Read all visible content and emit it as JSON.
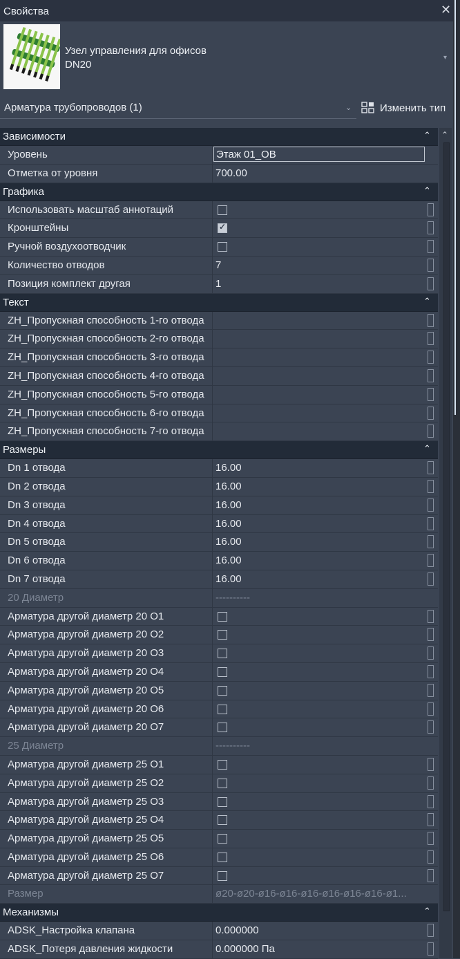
{
  "window": {
    "title": "Свойства",
    "close_symbol": "✕"
  },
  "header": {
    "type_line1": "Узел управления для офисов",
    "type_line2": "DN20",
    "dropdown_symbol": "▾"
  },
  "selector": {
    "value": "Арматура трубопроводов (1)",
    "arrow": "⌄",
    "change_type_label": "Изменить тип"
  },
  "symbols": {
    "collapse": "⌃",
    "scroll_up": "⌃"
  },
  "colors": {
    "panel_bg": "#3b4453",
    "category_bg": "#222b38",
    "titlebar_bg": "#2b3240"
  },
  "properties": [
    {
      "kind": "category",
      "name": "Зависимости"
    },
    {
      "kind": "row",
      "name": "Уровень",
      "value": "Этаж 01_ОВ",
      "edit": true
    },
    {
      "kind": "row",
      "name": "Отметка от уровня",
      "value": "700.00"
    },
    {
      "kind": "category",
      "name": "Графика"
    },
    {
      "kind": "row",
      "name": "Использовать масштаб аннотаций",
      "checkbox": false,
      "assoc": true
    },
    {
      "kind": "row",
      "name": "Кронштейны",
      "checkbox": true,
      "assoc": true
    },
    {
      "kind": "row",
      "name": "Ручной воздухоотводчик",
      "checkbox": false,
      "assoc": true
    },
    {
      "kind": "row",
      "name": "Количество отводов",
      "value": "7",
      "assoc": true
    },
    {
      "kind": "row",
      "name": "Позиция комплект другая",
      "value": "1",
      "assoc": true
    },
    {
      "kind": "category",
      "name": "Текст"
    },
    {
      "kind": "row",
      "name": "ZH_Пропускная способность 1-го отвода",
      "value": "",
      "assoc": true
    },
    {
      "kind": "row",
      "name": "ZH_Пропускная способность 2-го отвода",
      "value": "",
      "assoc": true
    },
    {
      "kind": "row",
      "name": "ZH_Пропускная способность 3-го отвода",
      "value": "",
      "assoc": true
    },
    {
      "kind": "row",
      "name": "ZH_Пропускная способность 4-го отвода",
      "value": "",
      "assoc": true
    },
    {
      "kind": "row",
      "name": "ZH_Пропускная способность 5-го отвода",
      "value": "",
      "assoc": true
    },
    {
      "kind": "row",
      "name": "ZH_Пропускная способность 6-го отвода",
      "value": "",
      "assoc": true
    },
    {
      "kind": "row",
      "name": "ZH_Пропускная способность 7-го отвода",
      "value": "",
      "assoc": true
    },
    {
      "kind": "category",
      "name": "Размеры"
    },
    {
      "kind": "row",
      "name": "Dn 1 отвода",
      "value": "16.00",
      "assoc": true
    },
    {
      "kind": "row",
      "name": "Dn 2 отвода",
      "value": "16.00",
      "assoc": true
    },
    {
      "kind": "row",
      "name": "Dn 3 отвода",
      "value": "16.00",
      "assoc": true
    },
    {
      "kind": "row",
      "name": "Dn 4 отвода",
      "value": "16.00",
      "assoc": true
    },
    {
      "kind": "row",
      "name": "Dn 5 отвода",
      "value": "16.00",
      "assoc": true
    },
    {
      "kind": "row",
      "name": "Dn 6 отвода",
      "value": "16.00",
      "assoc": true
    },
    {
      "kind": "row",
      "name": "Dn 7 отвода",
      "value": "16.00",
      "assoc": true
    },
    {
      "kind": "row",
      "name": "20 Диаметр",
      "value": "----------",
      "dim": true
    },
    {
      "kind": "row",
      "name": "Арматура другой диаметр 20 О1",
      "checkbox": false,
      "assoc": true
    },
    {
      "kind": "row",
      "name": "Арматура другой диаметр 20 О2",
      "checkbox": false,
      "assoc": true
    },
    {
      "kind": "row",
      "name": "Арматура другой диаметр 20 О3",
      "checkbox": false,
      "assoc": true
    },
    {
      "kind": "row",
      "name": "Арматура другой диаметр 20 О4",
      "checkbox": false,
      "assoc": true
    },
    {
      "kind": "row",
      "name": "Арматура другой диаметр 20 О5",
      "checkbox": false,
      "assoc": true
    },
    {
      "kind": "row",
      "name": "Арматура другой диаметр 20 О6",
      "checkbox": false,
      "assoc": true
    },
    {
      "kind": "row",
      "name": "Арматура другой диаметр 20 О7",
      "checkbox": false,
      "assoc": true
    },
    {
      "kind": "row",
      "name": "25 Диаметр",
      "value": "----------",
      "dim": true
    },
    {
      "kind": "row",
      "name": "Арматура другой диаметр 25 О1",
      "checkbox": false,
      "assoc": true
    },
    {
      "kind": "row",
      "name": "Арматура другой диаметр 25 О2",
      "checkbox": false,
      "assoc": true
    },
    {
      "kind": "row",
      "name": "Арматура другой диаметр 25 О3",
      "checkbox": false,
      "assoc": true
    },
    {
      "kind": "row",
      "name": "Арматура другой диаметр 25 О4",
      "checkbox": false,
      "assoc": true
    },
    {
      "kind": "row",
      "name": "Арматура другой диаметр 25 О5",
      "checkbox": false,
      "assoc": true
    },
    {
      "kind": "row",
      "name": "Арматура другой диаметр 25 О6",
      "checkbox": false,
      "assoc": true
    },
    {
      "kind": "row",
      "name": "Арматура другой диаметр 25 О7",
      "checkbox": false,
      "assoc": true
    },
    {
      "kind": "row",
      "name": "Размер",
      "value": "ø20-ø20-ø16-ø16-ø16-ø16-ø16-ø16-ø1...",
      "dim": true
    },
    {
      "kind": "category",
      "name": "Механизмы"
    },
    {
      "kind": "row",
      "name": "ADSK_Настройка клапана",
      "value": "0.000000",
      "assoc": true
    },
    {
      "kind": "row",
      "name": "ADSK_Потеря давления жидкости",
      "value": "0.000000 Па",
      "assoc": true
    }
  ]
}
